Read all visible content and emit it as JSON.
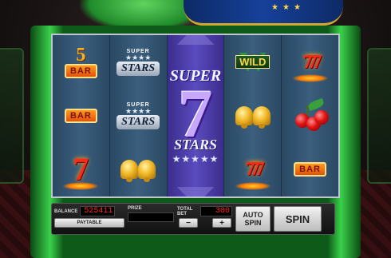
{
  "reels": [
    [
      "5 BAR",
      "BAR",
      "7"
    ],
    [
      "SUPER STARS",
      "SUPER STARS",
      "BELLS"
    ],
    [
      "SUPER 7 STARS WILD"
    ],
    [
      "WILD",
      "BELLS",
      "777"
    ],
    [
      "777",
      "CHERRIES",
      "BAR"
    ]
  ],
  "symbols": {
    "five_bar_num": "5",
    "bar_label": "BAR",
    "seven": "7",
    "triple_seven": "777",
    "superstars_top": "SUPER",
    "superstars_plate": "STARS",
    "superstars_stars": "★★★★",
    "wild_label": "WILD",
    "wild_w": "W",
    "wild_reel_super": "SUPER",
    "wild_reel_seven": "7",
    "wild_reel_stars": "STARS",
    "wild_reel_starrow": "★★★★★"
  },
  "panel": {
    "balance_label": "BALANCE",
    "balance_value": "525411",
    "prize_label": "PRIZE",
    "prize_value": "",
    "total_bet_label": "TOTAL BET",
    "total_bet_value": "300",
    "paytable_label": "PAYTABLE",
    "minus_label": "−",
    "plus_label": "+",
    "auto_spin_label": "AUTO SPIN",
    "spin_label": "SPIN"
  },
  "colors": {
    "frame_green": "#39d14a",
    "led_red": "#ff2b1a",
    "reel_blue": "#3b5f7e",
    "wild_purple": "#5a4bc0"
  }
}
